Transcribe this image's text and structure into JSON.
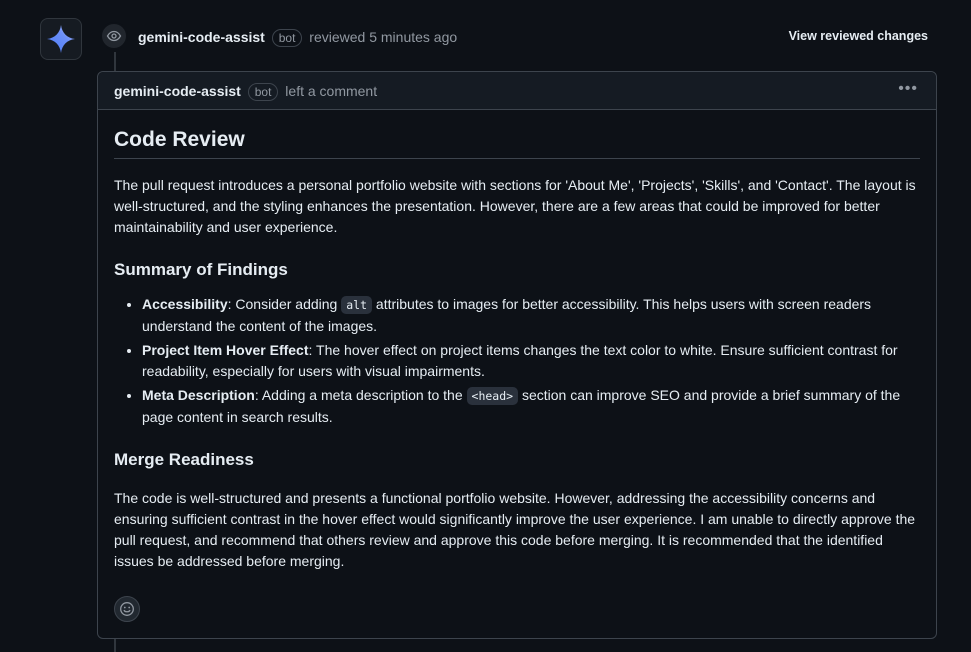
{
  "review": {
    "author": "gemini-code-assist",
    "badge": "bot",
    "action": "reviewed",
    "time": "5 minutes ago",
    "view_changes_label": "View reviewed changes"
  },
  "comment": {
    "author": "gemini-code-assist",
    "badge": "bot",
    "action": "left a comment",
    "title": "Code Review",
    "intro": "The pull request introduces a personal portfolio website with sections for 'About Me', 'Projects', 'Skills', and 'Contact'. The layout is well-structured, and the styling enhances the presentation. However, there are a few areas that could be improved for better maintainability and user experience.",
    "findings_heading": "Summary of Findings",
    "findings": [
      {
        "label": "Accessibility",
        "pre": ": Consider adding ",
        "code": "alt",
        "post": " attributes to images for better accessibility. This helps users with screen readers understand the content of the images."
      },
      {
        "label": "Project Item Hover Effect",
        "pre": ": The hover effect on project items changes the text color to white. Ensure sufficient contrast for readability, especially for users with visual impairments.",
        "code": "",
        "post": ""
      },
      {
        "label": "Meta Description",
        "pre": ": Adding a meta description to the ",
        "code": "<head>",
        "post": " section can improve SEO and provide a brief summary of the page content in search results."
      }
    ],
    "merge_heading": "Merge Readiness",
    "merge_text": "The code is well-structured and presents a functional portfolio website. However, addressing the accessibility concerns and ensuring sufficient contrast in the hover effect would significantly improve the user experience. I am unable to directly approve the pull request, and recommend that others review and approve this code before merging. It is recommended that the identified issues be addressed before merging."
  },
  "icons": {
    "avatar": "gemini-sparkle-icon",
    "review": "eye-icon",
    "menu": "kebab-icon",
    "reaction": "smiley-icon"
  },
  "colors": {
    "background": "#0d1117",
    "border": "#3d444d",
    "text": "#e6edf3",
    "muted": "#9198a1"
  }
}
